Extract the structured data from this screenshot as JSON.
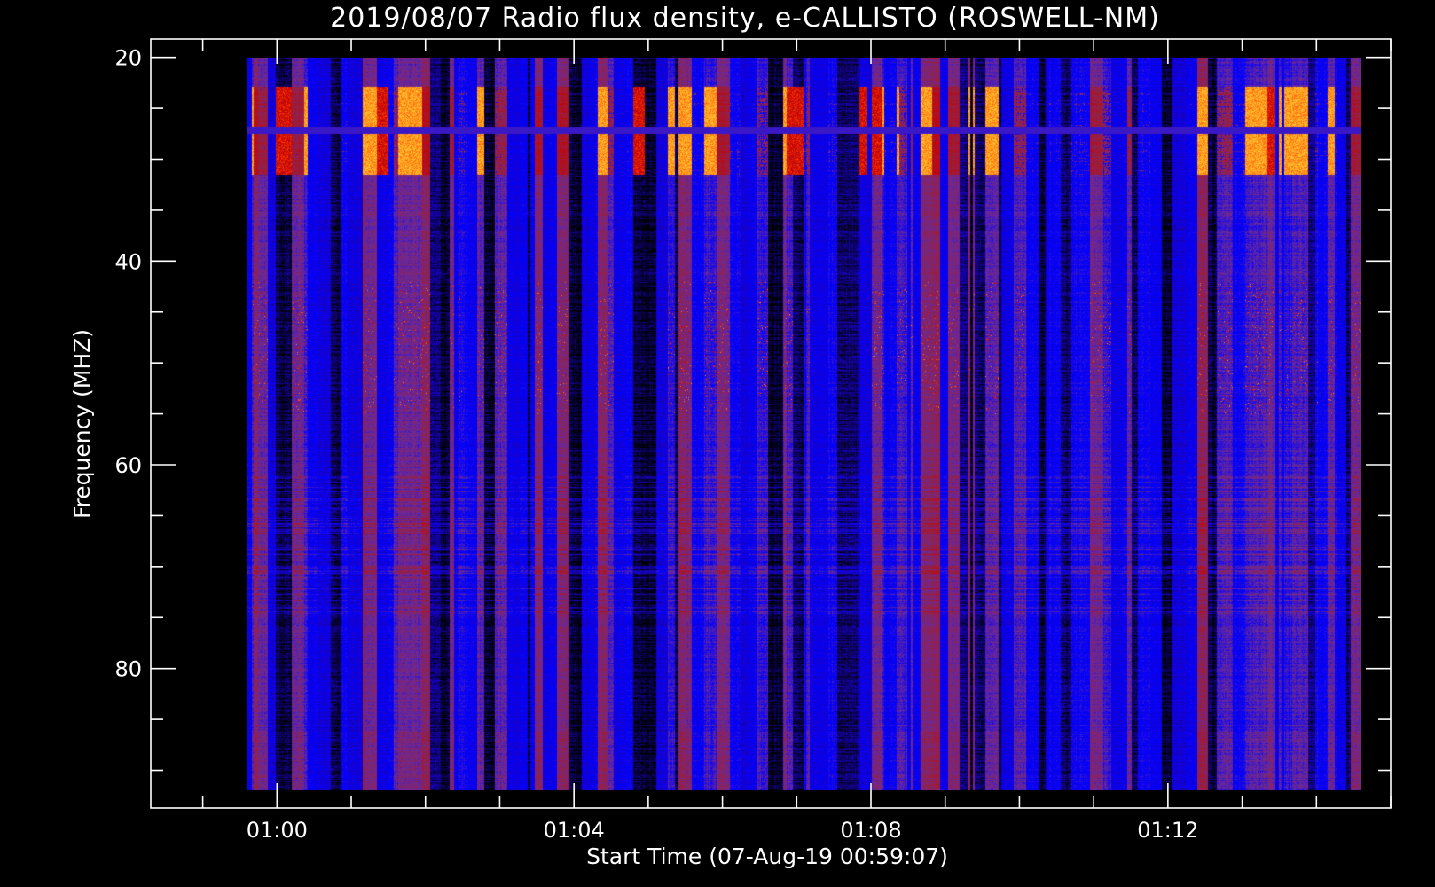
{
  "chart_data": {
    "type": "heatmap",
    "title": "2019/08/07  Radio flux density, e-CALLISTO (ROSWELL-NM)",
    "xlabel": "Start Time (07-Aug-19 00:59:07)",
    "ylabel": "Frequency (MHZ)",
    "x_unit": "UT time",
    "x_range": [
      "00:58:18",
      "01:15:00"
    ],
    "data_extent_x": [
      "00:59:36",
      "01:14:36"
    ],
    "y_range": [
      18.2,
      93.7
    ],
    "y_inverted": true,
    "data_extent_y": [
      20,
      92
    ],
    "x_ticks": [
      "01:00",
      "01:04",
      "01:08",
      "01:12"
    ],
    "y_ticks": [
      20,
      40,
      60,
      80
    ],
    "colormap": [
      "#000000",
      "#1a00c8",
      "#0000ff",
      "#6a2a9a",
      "#9a1f3c",
      "#c80000",
      "#ff3a00",
      "#ffa020",
      "#ffe840"
    ],
    "grid": false,
    "legend": "none",
    "features": [
      {
        "description": "strong periodic bursts",
        "freq_range_mhz": [
          22.8,
          31.5
        ],
        "level": "high"
      },
      {
        "description": "horizontal interference line",
        "freq_mhz": 27.1,
        "level": "medium"
      },
      {
        "description": "intermittent emission cluster",
        "freq_range_mhz": [
          42,
          55
        ],
        "level": "medium-high"
      },
      {
        "description": "horizontal interference bands",
        "freq_range_mhz": [
          61,
          75
        ],
        "level": "low-medium"
      }
    ]
  },
  "colors": {
    "background": "#000000",
    "axes": "#ffffff",
    "text": "#ffffff"
  }
}
